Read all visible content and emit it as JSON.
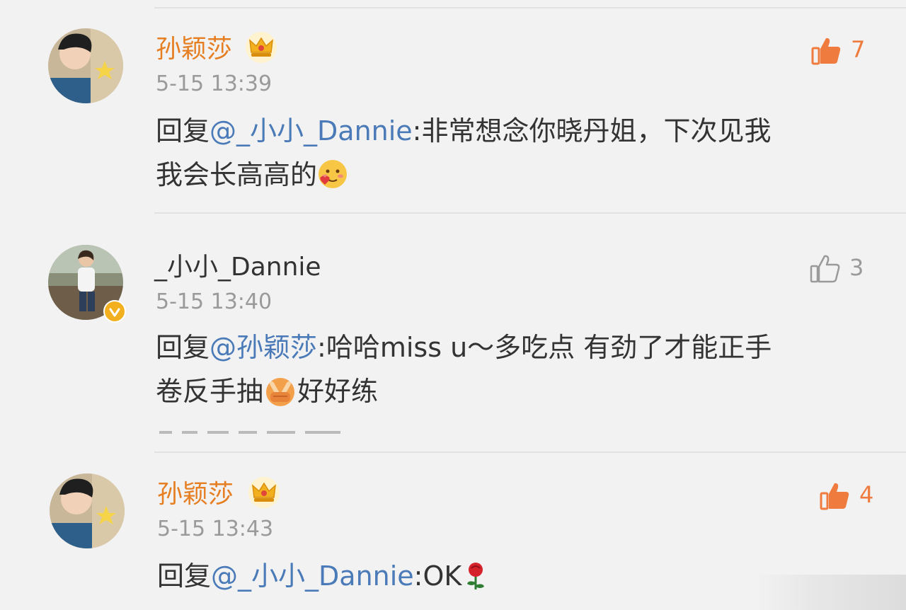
{
  "comments": [
    {
      "author": "孙颖莎",
      "time": "5-15 13:39",
      "reply_prefix": "回复",
      "mention": "@_小小_Dannie",
      "text_line1": ":非常想念你晓丹姐，下次见我",
      "text_line2": "我会长高高的",
      "likes": "7",
      "liked": true,
      "emoji": "blushing-face-with-heart"
    },
    {
      "author": "_小小_Dannie",
      "time": "5-15 13:40",
      "reply_prefix": "回复",
      "mention": "@孙颖莎",
      "text_line1": ":哈哈miss u～多吃点 有劲了才能正手",
      "text_line2_a": "卷反手抽",
      "text_line2_b": "好好练",
      "likes": "3",
      "liked": false,
      "emoji": "fist-hands"
    },
    {
      "author": "孙颖莎",
      "time": "5-15 13:43",
      "reply_prefix": "回复",
      "mention": "@_小小_Dannie",
      "text_line1": ":OK",
      "likes": "4",
      "liked": true,
      "emoji": "rose"
    }
  ],
  "colors": {
    "vip_name": "#e67e22",
    "mention": "#4a7ab8",
    "like_active": "#f07b3f",
    "timestamp": "#9a9a9a"
  },
  "icons": [
    "thumbs-up-icon",
    "crown-badge-icon",
    "verified-badge-icon"
  ]
}
